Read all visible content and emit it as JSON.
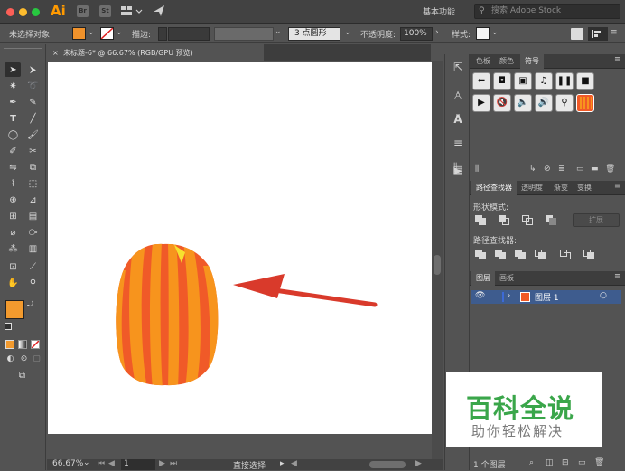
{
  "app": {
    "logo": "Ai",
    "workspace": "基本功能",
    "search_placeholder": "搜索 Adobe Stock",
    "toolbar_icons": [
      "br-icon",
      "st-icon",
      "arrange-documents-icon",
      "send-icon"
    ]
  },
  "control_bar": {
    "selection_label": "未选择对象",
    "fill_color": "#f0922b",
    "stroke_label": "描边:",
    "brush_label": "3 点圆形",
    "opacity_label": "不透明度:",
    "opacity_value": "100%",
    "style_label": "样式:"
  },
  "document": {
    "tab_title": "未标题-6* @ 66.67% (RGB/GPU 预览)",
    "zoom": "66.67%",
    "page": "1",
    "status_tool": "直接选择"
  },
  "tools_panel": {
    "fill_color": "#f29a2e",
    "stroke_color": "#ffffff"
  },
  "panels": {
    "swatch_tabs": [
      "色板",
      "颜色",
      "符号"
    ],
    "active_swatch_tab": "符号",
    "symbols": [
      "arrow-left-icon",
      "camera-icon",
      "film-icon",
      "music-icon",
      "pause-icon",
      "stop-icon",
      "play-icon",
      "mute-icon",
      "volume-low-icon",
      "volume-high-icon",
      "search-icon",
      "orange-pattern-icon"
    ],
    "pathfinder_tabs": [
      "路径查找器",
      "透明度",
      "渐变",
      "变换"
    ],
    "shape_modes_label": "形状模式:",
    "expand_label": "扩展",
    "pathfinders_label": "路径查找器:",
    "layers_tabs": [
      "图层",
      "画板"
    ],
    "layer_name": "图层 1",
    "layer_color": "#3d6ad6",
    "layers_count": "1 个图层"
  },
  "watermark": {
    "title": "百科全说",
    "subtitle": "助你轻松解决",
    "title_color": "#3aa64a"
  },
  "artwork": {
    "shape": "pumpkin",
    "pumpkin_colors": [
      "#f05a28",
      "#f7941d"
    ],
    "arrow_color": "#d93a2b",
    "arrow_direction": "pointing-left"
  }
}
